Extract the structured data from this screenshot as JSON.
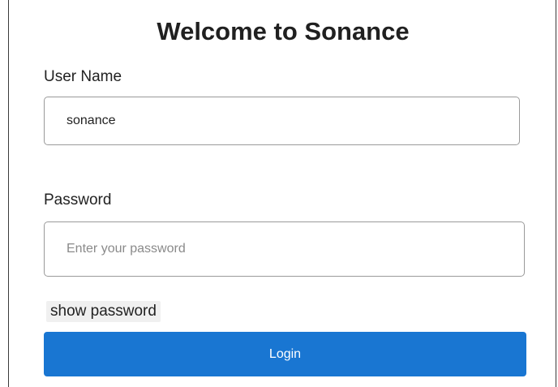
{
  "login": {
    "title": "Welcome to Sonance",
    "username": {
      "label": "User Name",
      "value": "sonance",
      "placeholder": ""
    },
    "password": {
      "label": "Password",
      "value": "",
      "placeholder": "Enter your password"
    },
    "show_password_label": "show password",
    "login_label": "Login"
  },
  "colors": {
    "primary_button": "#1976d2",
    "show_password_bg": "#f0f0f0",
    "input_border": "#9a9a9a"
  }
}
